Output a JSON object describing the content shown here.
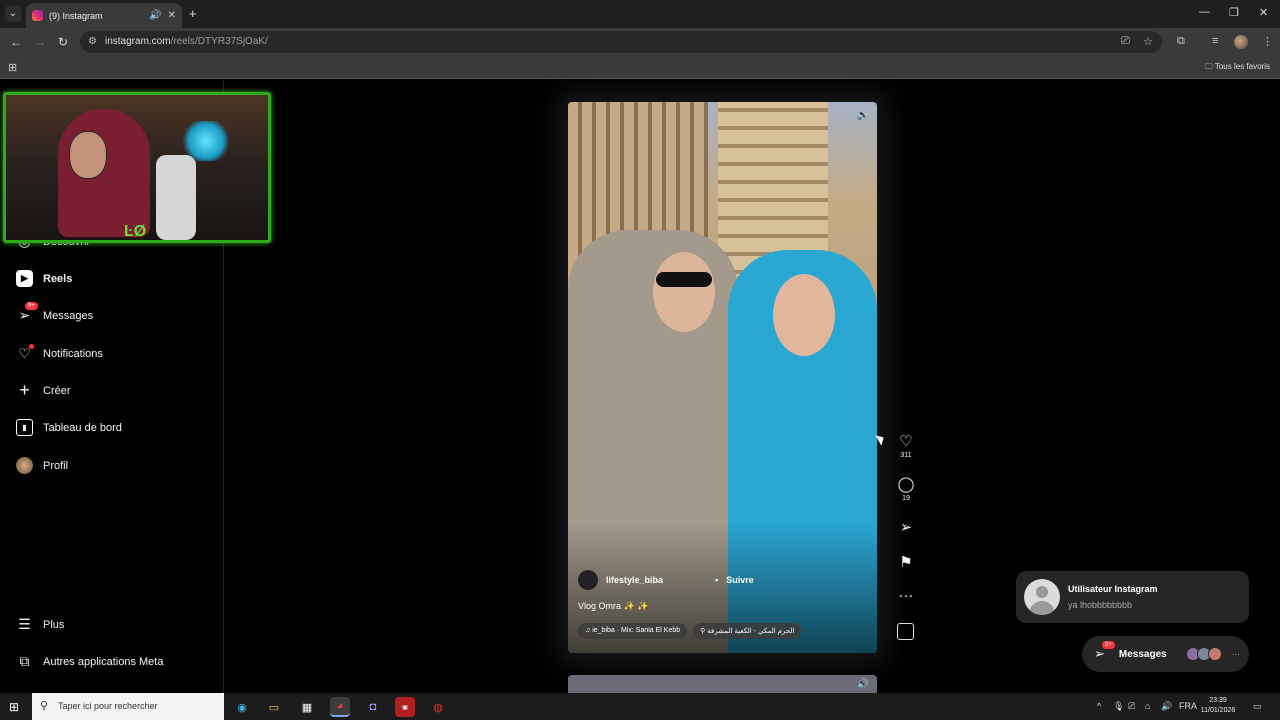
{
  "browser": {
    "tab": {
      "title": "(9) Instagram"
    },
    "url": {
      "domain": "instagram.com",
      "path": "/reels/DTYR37SjOaK/"
    },
    "bookmarks": {
      "all_favorites": "Tous les favoris"
    }
  },
  "sidebar": {
    "items": [
      {
        "label": "Découvrir",
        "icon": "compass-icon"
      },
      {
        "label": "Reels",
        "icon": "reels-icon"
      },
      {
        "label": "Messages",
        "icon": "messenger-icon",
        "badge": "9+"
      },
      {
        "label": "Notifications",
        "icon": "heart-icon"
      },
      {
        "label": "Créer",
        "icon": "plus-icon"
      },
      {
        "label": "Tableau de bord",
        "icon": "chart-icon"
      },
      {
        "label": "Profil",
        "icon": "avatar-icon"
      }
    ],
    "bottom": [
      {
        "label": "Plus",
        "icon": "menu-icon"
      },
      {
        "label": "Autres applications Meta",
        "icon": "meta-apps-icon"
      }
    ]
  },
  "reel": {
    "username": "lifestyle_biba",
    "separator": "•",
    "follow": "Suivre",
    "caption": "Vlog Omra ✨ ✨",
    "audio": "ie_biba · Mix: Sania El Kebb",
    "location": "الحرم المكي - الكعبة المشرفة",
    "likes": "311",
    "comments": "19"
  },
  "notification": {
    "name": "Utilisateur Instagram",
    "message": "ya lhobbbbbbbb"
  },
  "messages_pill": {
    "label": "Messages",
    "badge": "9+"
  },
  "taskbar": {
    "search_placeholder": "Taper ici pour rechercher",
    "language": "FRA",
    "time": "23:39",
    "date": "11/01/2026"
  },
  "colors": {
    "accent": "#ff3040",
    "webcam_border": "#2faa1a"
  }
}
